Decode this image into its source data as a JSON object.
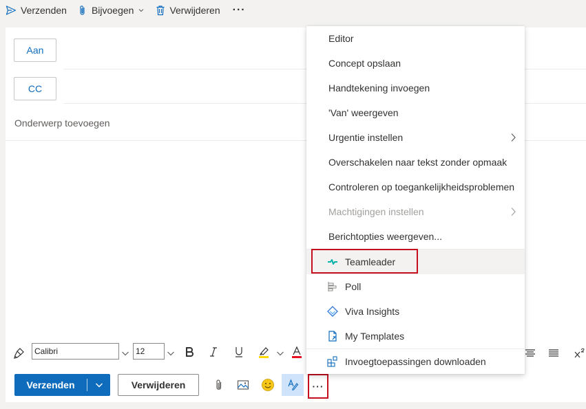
{
  "toolbar": {
    "send": "Verzenden",
    "attach": "Bijvoegen",
    "delete": "Verwijderen",
    "more": "···"
  },
  "compose": {
    "to_label": "Aan",
    "cc_label": "CC",
    "subject_placeholder": "Onderwerp toevoegen"
  },
  "format": {
    "font_name": "Calibri",
    "font_size": "12"
  },
  "actions": {
    "send": "Verzenden",
    "discard": "Verwijderen",
    "more": "···"
  },
  "menu": {
    "items": [
      {
        "label": "Editor"
      },
      {
        "label": "Concept opslaan"
      },
      {
        "label": "Handtekening invoegen"
      },
      {
        "label": "'Van' weergeven"
      },
      {
        "label": "Urgentie instellen"
      },
      {
        "label": "Overschakelen naar tekst zonder opmaak"
      },
      {
        "label": "Controleren op toegankelijkheidsproblemen"
      },
      {
        "label": "Machtigingen instellen"
      },
      {
        "label": "Berichtopties weergeven..."
      }
    ],
    "addins": [
      {
        "label": "Teamleader",
        "icon": "teamleader-icon"
      },
      {
        "label": "Poll",
        "icon": "poll-icon"
      },
      {
        "label": "Viva Insights",
        "icon": "viva-insights-icon"
      },
      {
        "label": "My Templates",
        "icon": "my-templates-icon"
      }
    ],
    "get_addins": "Invoegtoepassingen downloaden"
  },
  "colors": {
    "accent": "#0f6cbd",
    "highlight_box": "#c50f1f"
  }
}
